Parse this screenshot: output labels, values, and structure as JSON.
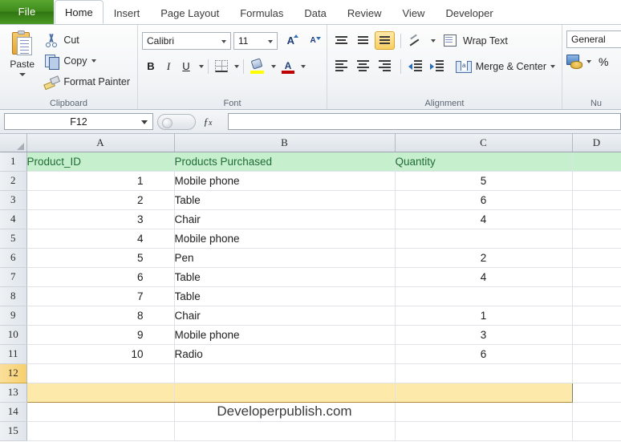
{
  "ribbon": {
    "file_tab": "File",
    "tabs": [
      {
        "label": "Home",
        "active": true
      },
      {
        "label": "Insert",
        "active": false
      },
      {
        "label": "Page Layout",
        "active": false
      },
      {
        "label": "Formulas",
        "active": false
      },
      {
        "label": "Data",
        "active": false
      },
      {
        "label": "Review",
        "active": false
      },
      {
        "label": "View",
        "active": false
      },
      {
        "label": "Developer",
        "active": false
      }
    ],
    "clipboard": {
      "group_label": "Clipboard",
      "paste": "Paste",
      "cut": "Cut",
      "copy": "Copy",
      "format_painter": "Format Painter"
    },
    "font": {
      "group_label": "Font",
      "font_name": "Calibri",
      "font_size": "11",
      "bold": "B",
      "italic": "I",
      "underline": "U",
      "grow_font": "A",
      "shrink_font": "A",
      "fill_color_hex": "#FFFF00",
      "font_color_hex": "#C00000"
    },
    "alignment": {
      "group_label": "Alignment",
      "wrap_text": "Wrap Text",
      "merge_center": "Merge & Center"
    },
    "number": {
      "group_label": "Nu",
      "format": "General",
      "percent": "%"
    }
  },
  "formula_bar": {
    "name_box": "F12",
    "formula": ""
  },
  "grid": {
    "columns": [
      "A",
      "B",
      "C",
      "D"
    ],
    "header_fill_hex": "#C6EFCE",
    "header_text_hex": "#206C33",
    "highlight_fill_hex": "#FDE9A9",
    "active_row": "12",
    "rows": [
      {
        "n": "1",
        "type": "header",
        "a": "Product_ID",
        "b": "Products Purchased",
        "c": "Quantity"
      },
      {
        "n": "2",
        "type": "data",
        "a": "1",
        "b": "Mobile phone",
        "c": "5"
      },
      {
        "n": "3",
        "type": "data",
        "a": "2",
        "b": "Table",
        "c": "6"
      },
      {
        "n": "4",
        "type": "data",
        "a": "3",
        "b": "Chair",
        "c": "4"
      },
      {
        "n": "5",
        "type": "data",
        "a": "4",
        "b": "Mobile phone",
        "c": ""
      },
      {
        "n": "6",
        "type": "data",
        "a": "5",
        "b": "Pen",
        "c": "2"
      },
      {
        "n": "7",
        "type": "data",
        "a": "6",
        "b": "Table",
        "c": "4"
      },
      {
        "n": "8",
        "type": "data",
        "a": "7",
        "b": "Table",
        "c": ""
      },
      {
        "n": "9",
        "type": "data",
        "a": "8",
        "b": "Chair",
        "c": "1"
      },
      {
        "n": "10",
        "type": "data",
        "a": "9",
        "b": "Mobile phone",
        "c": "3"
      },
      {
        "n": "11",
        "type": "data",
        "a": "10",
        "b": "Radio",
        "c": "6"
      },
      {
        "n": "12",
        "type": "empty",
        "a": "",
        "b": "",
        "c": ""
      },
      {
        "n": "13",
        "type": "filled",
        "a": "",
        "b": "",
        "c": ""
      },
      {
        "n": "14",
        "type": "watermark",
        "a": "",
        "b": "Developerpublish.com",
        "c": ""
      },
      {
        "n": "15",
        "type": "empty",
        "a": "",
        "b": "",
        "c": ""
      }
    ]
  }
}
